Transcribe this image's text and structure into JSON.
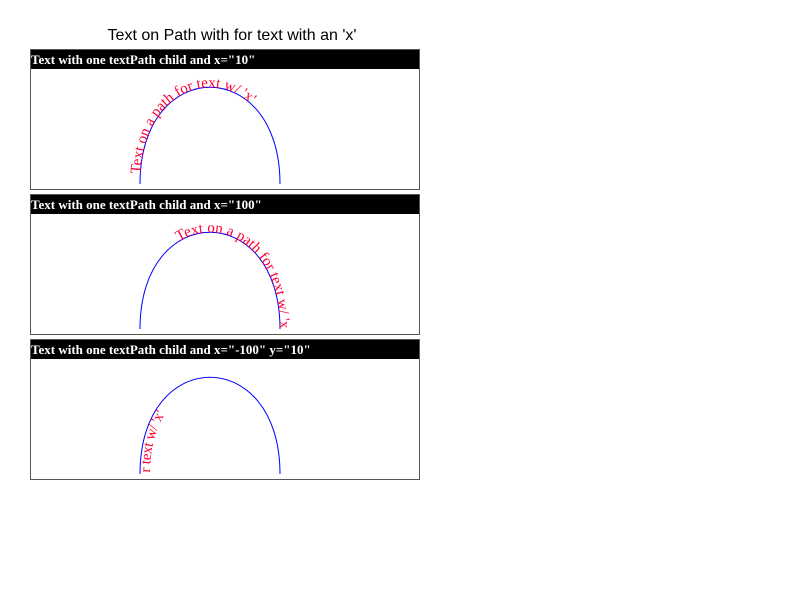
{
  "title": "Text on Path with for text with an 'x'",
  "path_text": "Text on a path for text w/ 'x'",
  "colors": {
    "text": "#ff0033",
    "path": "#0000ff",
    "header_bg": "#000000",
    "header_text": "#ffffff",
    "border": "#555555"
  },
  "panels": [
    {
      "heading": "Text with one textPath child and x=\"10\""
    },
    {
      "heading": "Text with one textPath child and x=\"100\""
    },
    {
      "heading": "Text with one textPath child and x=\"-100\" y=\"10\""
    }
  ]
}
